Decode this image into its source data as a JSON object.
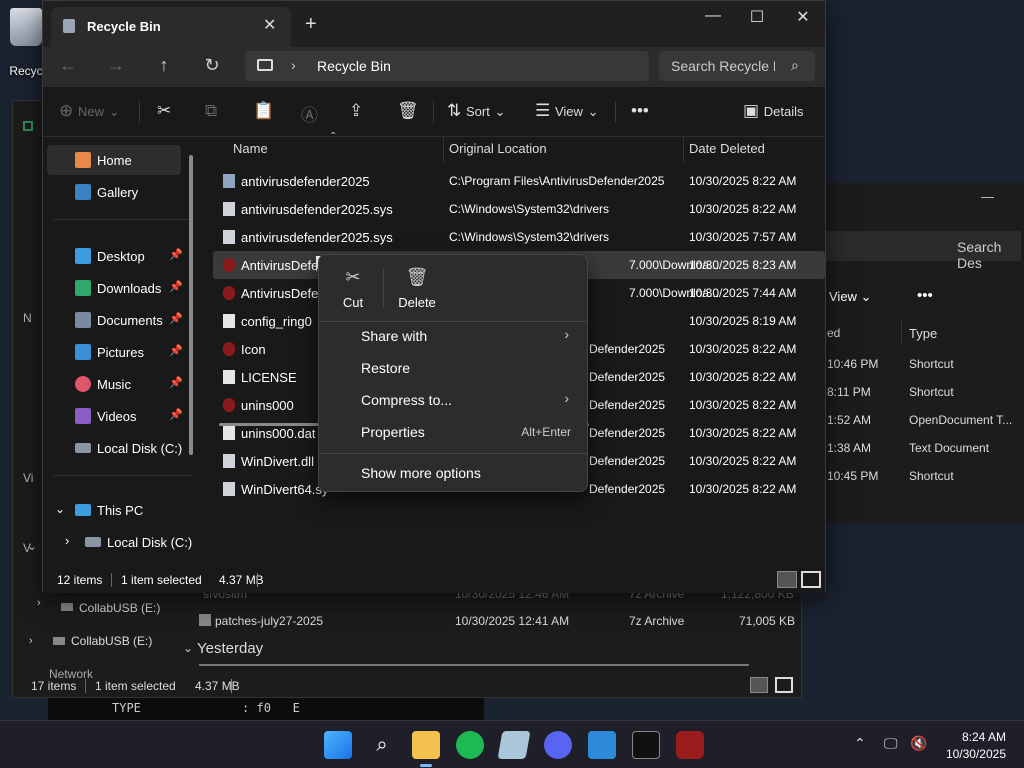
{
  "desktop": {
    "recycle_label": "Recyc"
  },
  "main": {
    "tab_title": "Recycle Bin",
    "newtab": "+",
    "address": "Recycle Bin",
    "search_placeholder": "Search Recycle Bin",
    "toolbar": {
      "new": "New",
      "sort": "Sort",
      "view": "View",
      "details": "Details"
    },
    "nav": {
      "home": "Home",
      "gallery": "Gallery",
      "desktop": "Desktop",
      "downloads": "Downloads",
      "documents": "Documents",
      "pictures": "Pictures",
      "music": "Music",
      "videos": "Videos",
      "localdisk": "Local Disk (C:)",
      "thispc": "This PC",
      "localdisk2": "Local Disk (C:)"
    },
    "columns": {
      "name": "Name",
      "location": "Original Location",
      "date": "Date Deleted"
    },
    "rows": [
      {
        "name": "antivirusdefender2025",
        "location": "C:\\Program Files\\AntivirusDefender2025",
        "date": "10/30/2025 8:22 AM"
      },
      {
        "name": "antivirusdefender2025.sys",
        "location": "C:\\Windows\\System32\\drivers",
        "date": "10/30/2025 8:22 AM"
      },
      {
        "name": "antivirusdefender2025.sys",
        "location": "C:\\Windows\\System32\\drivers",
        "date": "10/30/2025 7:57 AM"
      },
      {
        "name": "AntivirusDefen",
        "location": "7.000\\Downloa...",
        "date": "10/30/2025 8:23 AM"
      },
      {
        "name": "AntivirusDefen",
        "location": "7.000\\Downloa...",
        "date": "10/30/2025 7:44 AM"
      },
      {
        "name": "config_ring0",
        "location": "",
        "date": "10/30/2025 8:19 AM"
      },
      {
        "name": "Icon",
        "location": "Defender2025",
        "date": "10/30/2025 8:22 AM"
      },
      {
        "name": "LICENSE",
        "location": "Defender2025",
        "date": "10/30/2025 8:22 AM"
      },
      {
        "name": "unins000",
        "location": "Defender2025",
        "date": "10/30/2025 8:22 AM"
      },
      {
        "name": "unins000.dat",
        "location": "Defender2025",
        "date": "10/30/2025 8:22 AM"
      },
      {
        "name": "WinDivert.dll",
        "location": "Defender2025",
        "date": "10/30/2025 8:22 AM"
      },
      {
        "name": "WinDivert64.sy",
        "location": "Defender2025",
        "date": "10/30/2025 8:22 AM"
      }
    ],
    "status": {
      "count": "12 items",
      "selected": "1 item selected",
      "size": "4.37 MB"
    }
  },
  "context_menu": {
    "cut": "Cut",
    "delete": "Delete",
    "items": [
      "Share with",
      "Restore",
      "Compress to...",
      "Properties",
      "Show more options"
    ],
    "properties_shortcut": "Alt+Enter"
  },
  "back": {
    "search": "Search Des",
    "view": "View",
    "col_ed": "ed",
    "col_type": "Type",
    "right_rows": [
      {
        "time": "10:46 PM",
        "type": "Shortcut"
      },
      {
        "time": "8:11 PM",
        "type": "Shortcut"
      },
      {
        "time": "1:52 AM",
        "type": "OpenDocument T..."
      },
      {
        "time": "1:38 AM",
        "type": "Text Document"
      },
      {
        "time": "10:45 PM",
        "type": "Shortcut"
      }
    ],
    "row_sfvo": {
      "name": "sfvositm",
      "date": "10/30/2025 12:46 AM",
      "type": "7z Archive",
      "size": "1,122,800 KB"
    },
    "row_patches": {
      "name": "patches-july27-2025",
      "date": "10/30/2025 12:41 AM",
      "type": "7z Archive",
      "size": "71,005 KB"
    },
    "group": "Yesterday",
    "nav1": "CollabUSB (E:)",
    "nav2": "CollabUSB (E:)",
    "nav3": "Network",
    "status": {
      "count": "17 items",
      "selected": "1 item selected",
      "size": "4.37 MB"
    }
  },
  "terminal": {
    "line": "TYPE              : f0   E"
  },
  "taskbar": {
    "time": "8:24 AM",
    "date": "10/30/2025"
  }
}
